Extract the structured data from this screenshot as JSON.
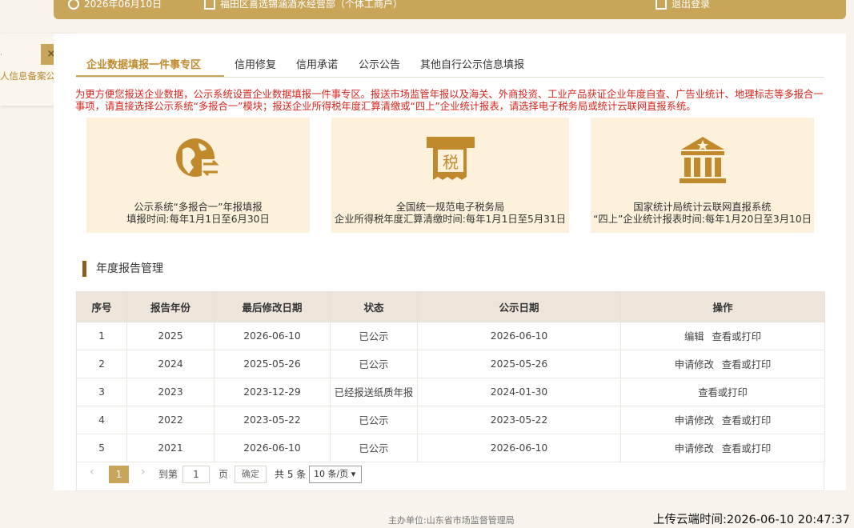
{
  "topbar": {
    "date": "2026年06月10日",
    "company": "福田区喜选锦涵酒水经营部（个体工商户）",
    "logout": "退出登录"
  },
  "floating_panel": {
    "close": "×",
    "dot": "·",
    "text": "人信息备案公告"
  },
  "tabs": [
    {
      "label": "企业数据填报一件事专区",
      "active": true
    },
    {
      "label": "信用修复",
      "active": false
    },
    {
      "label": "信用承诺",
      "active": false
    },
    {
      "label": "公示公告",
      "active": false
    },
    {
      "label": "其他自行公示信息填报",
      "active": false
    }
  ],
  "notice": "为更方便您报送企业数据，公示系统设置企业数据填报一件事专区。报送市场监管年报以及海关、外商投资、工业产品获证企业年度自查、广告业统计、地理标志等多报合一事项，请直接选择公示系统“多报合一”模块；报送企业所得税年度汇算清缴或“四上”企业统计报表，请选择电子税务局或统计云联网直报系统。",
  "cards": [
    {
      "icon": "globe-exchange-icon",
      "line1": "公示系统“多报合一”年报填报",
      "line2": "填报时间:每年1月1日至6月30日"
    },
    {
      "icon": "tax-ticket-icon",
      "glyph": "税",
      "line1": "全国统一规范电子税务局",
      "line2": "企业所得税年度汇算清缴时间:每年1月1日至5月31日"
    },
    {
      "icon": "government-building-icon",
      "line1": "国家统计局统计云联网直报系统",
      "line2": "“四上”企业统计报表时间:每年1月20日至3月10日"
    }
  ],
  "section_title": "年度报告管理",
  "table": {
    "headers": [
      "序号",
      "报告年份",
      "最后修改日期",
      "状态",
      "公示日期",
      "操作"
    ],
    "rows": [
      {
        "no": "1",
        "year": "2025",
        "modified": "2026-06-10",
        "status": "已公示",
        "published": "2026-06-10",
        "ops": [
          "编辑",
          "查看或打印"
        ]
      },
      {
        "no": "2",
        "year": "2024",
        "modified": "2025-05-26",
        "status": "已公示",
        "published": "2025-05-26",
        "ops": [
          "申请修改",
          "查看或打印"
        ]
      },
      {
        "no": "3",
        "year": "2023",
        "modified": "2023-12-29",
        "status": "已经报送纸质年报",
        "published": "2024-01-30",
        "ops": [
          "查看或打印"
        ]
      },
      {
        "no": "4",
        "year": "2022",
        "modified": "2023-05-22",
        "status": "已公示",
        "published": "2023-05-22",
        "ops": [
          "申请修改",
          "查看或打印"
        ]
      },
      {
        "no": "5",
        "year": "2021",
        "modified": "2026-06-10",
        "status": "已公示",
        "published": "2026-06-10",
        "ops": [
          "申请修改",
          "查看或打印"
        ]
      }
    ]
  },
  "pager": {
    "prev": "‹",
    "current": "1",
    "next": "›",
    "goto_label": "到第",
    "goto_value": "1",
    "page_unit": "页",
    "confirm": "确定",
    "total": "共 5 条",
    "page_size": "10 条/页"
  },
  "footer": "主办单位:山东省市场监督管理局",
  "upload_time": "上传云端时间:2026-06-10 20:47:37"
}
